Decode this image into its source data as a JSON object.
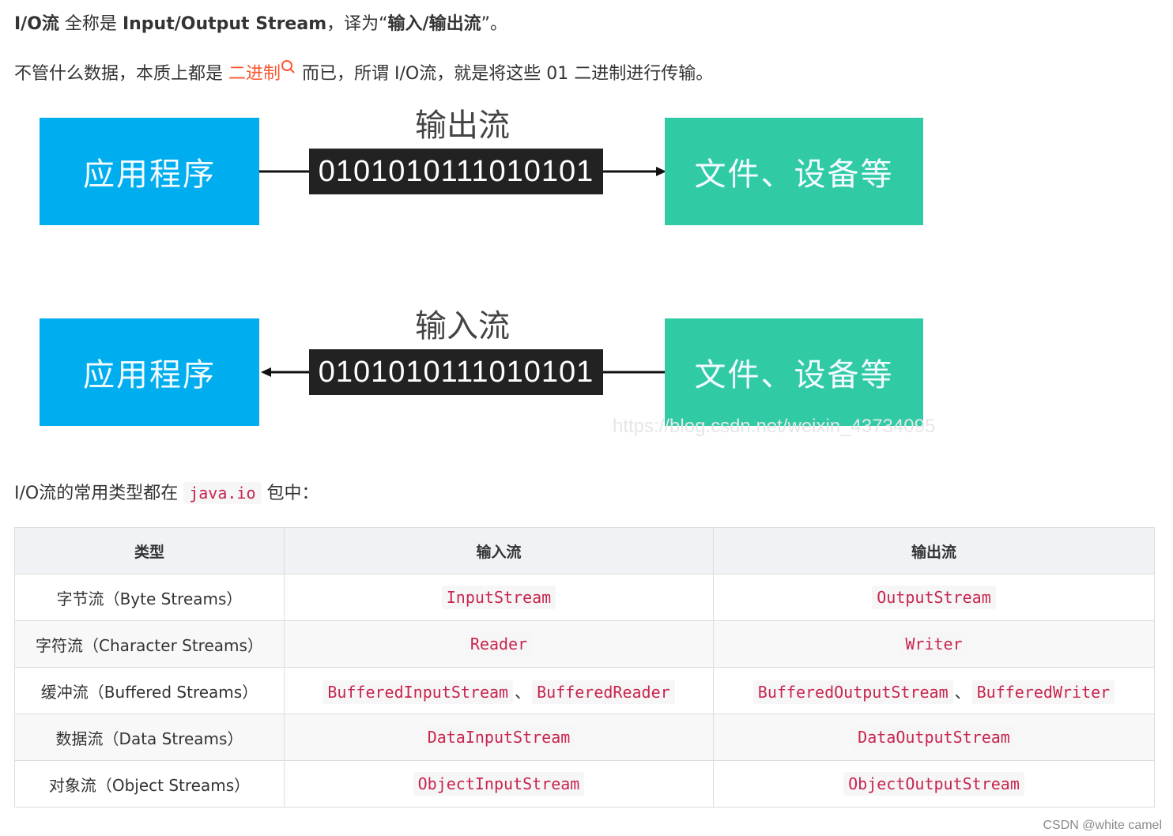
{
  "intro": {
    "line1_term": "I/O流",
    "line1_mid": " 全称是 ",
    "line1_full": "Input/Output Stream",
    "line1_after": "，译为“",
    "line1_trans": "输入/输出流",
    "line1_end": "”。",
    "line2_pre": "不管什么数据，本质上都是 ",
    "line2_link": "二进制",
    "line2_post": " 而已，所谓 I/O流，就是将这些 01 二进制进行传输。"
  },
  "diagram": {
    "output": {
      "label": "输出流",
      "app": "应用程序",
      "bits": "0101010111010101",
      "device": "文件、设备等"
    },
    "input": {
      "label": "输入流",
      "app": "应用程序",
      "bits": "0101010111010101",
      "device": "文件、设备等"
    },
    "watermark": "https://blog.csdn.net/weixin_43734095",
    "colors": {
      "app": "#00adef",
      "device": "#30cba5",
      "bits": "#222222"
    }
  },
  "para3": {
    "pre": "I/O流的常用类型都在 ",
    "code": "java.io",
    "post": " 包中："
  },
  "table": {
    "headers": [
      "类型",
      "输入流",
      "输出流"
    ],
    "separator": "、",
    "rows": [
      {
        "type": "字节流（Byte Streams）",
        "input": [
          "InputStream"
        ],
        "output": [
          "OutputStream"
        ]
      },
      {
        "type": "字符流（Character Streams）",
        "input": [
          "Reader"
        ],
        "output": [
          "Writer"
        ]
      },
      {
        "type": "缓冲流（Buffered Streams）",
        "input": [
          "BufferedInputStream",
          "BufferedReader"
        ],
        "output": [
          "BufferedOutputStream",
          "BufferedWriter"
        ]
      },
      {
        "type": "数据流（Data Streams）",
        "input": [
          "DataInputStream"
        ],
        "output": [
          "DataOutputStream"
        ]
      },
      {
        "type": "对象流（Object Streams）",
        "input": [
          "ObjectInputStream"
        ],
        "output": [
          "ObjectOutputStream"
        ]
      }
    ]
  },
  "footer": "CSDN @white camel"
}
